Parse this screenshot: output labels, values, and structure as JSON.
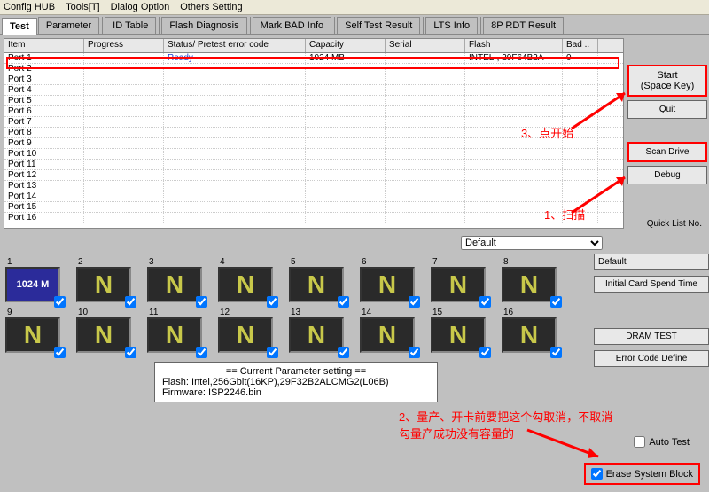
{
  "menu": {
    "config_hub": "Config HUB",
    "tools": "Tools[T]",
    "dialog": "Dialog Option",
    "others": "Others Setting"
  },
  "tabs": {
    "test": "Test",
    "parameter": "Parameter",
    "id_table": "ID Table",
    "flash_diag": "Flash Diagnosis",
    "mark_bad": "Mark BAD Info",
    "self_test": "Self Test Result",
    "lts": "LTS Info",
    "rdt": "8P RDT Result"
  },
  "grid": {
    "headers": {
      "item": "Item",
      "progress": "Progress",
      "status": "Status/ Pretest error code",
      "capacity": "Capacity",
      "serial": "Serial",
      "flash": "Flash",
      "bad": "Bad .."
    },
    "rows": [
      {
        "item": "Port 1",
        "progress": "",
        "status": "Ready",
        "capacity": "1024 MB",
        "serial": "",
        "flash": "INTEL-, 29F64B2A",
        "bad": "0"
      },
      {
        "item": "Port 2"
      },
      {
        "item": "Port 3"
      },
      {
        "item": "Port 4"
      },
      {
        "item": "Port 5"
      },
      {
        "item": "Port 6"
      },
      {
        "item": "Port 7"
      },
      {
        "item": "Port 8"
      },
      {
        "item": "Port 9"
      },
      {
        "item": "Port 10"
      },
      {
        "item": "Port 11"
      },
      {
        "item": "Port 12"
      },
      {
        "item": "Port 13"
      },
      {
        "item": "Port 14"
      },
      {
        "item": "Port 15"
      },
      {
        "item": "Port 16"
      }
    ]
  },
  "buttons": {
    "start_l1": "Start",
    "start_l2": "(Space Key)",
    "quit": "Quit",
    "scan": "Scan Drive",
    "debug": "Debug",
    "quick": "Quick List No.",
    "dram": "DRAM TEST",
    "err_code": "Error Code Define",
    "default_lbl": "Default",
    "init_card": "Initial Card Spend Time"
  },
  "dropdown": {
    "default": "Default"
  },
  "ports": {
    "labels": [
      "1",
      "2",
      "3",
      "4",
      "5",
      "6",
      "7",
      "8",
      "9",
      "10",
      "11",
      "12",
      "13",
      "14",
      "15",
      "16"
    ],
    "ready_display": "1024 M"
  },
  "param": {
    "title": "== Current Parameter setting ==",
    "flash": "Flash:   Intel,256Gbit(16KP),29F32B2ALCMG2(L06B)",
    "firmware": "Firmware:   ISP2246.bin"
  },
  "anno": {
    "a1": "1、扫描",
    "a2": "2、量产、开卡前要把这个勾取消，不取消勾量产成功没有容量的",
    "a3": "3、点开始"
  },
  "checks": {
    "auto": "Auto Test",
    "erase": "Erase System Block"
  }
}
